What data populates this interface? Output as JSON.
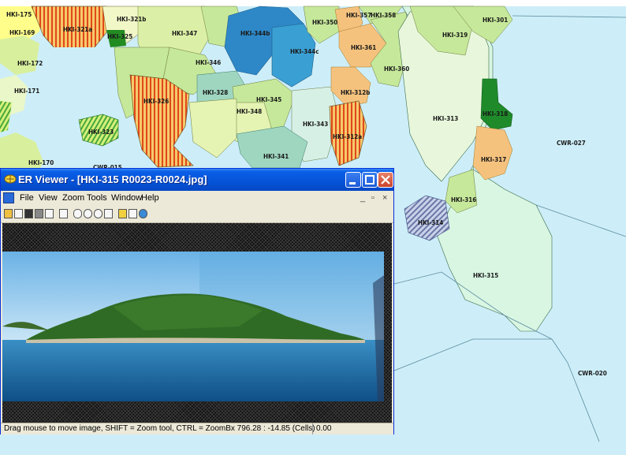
{
  "map": {
    "labels": [
      {
        "id": "HKI-175",
        "text": "HKI-175"
      },
      {
        "id": "HKI-169",
        "text": "HKI-169"
      },
      {
        "id": "HKI-172",
        "text": "HKI-172"
      },
      {
        "id": "HKI-171",
        "text": "HKI-171"
      },
      {
        "id": "HKI-170",
        "text": "HKI-170"
      },
      {
        "id": "HKI-321a",
        "text": "HKI-321a"
      },
      {
        "id": "HKI-321b",
        "text": "HKI-321b"
      },
      {
        "id": "HKI-325",
        "text": "HKI-325"
      },
      {
        "id": "HKI-347",
        "text": "HKI-347"
      },
      {
        "id": "HKI-344b",
        "text": "HKI-344b"
      },
      {
        "id": "HKI-344c",
        "text": "HKI-344c"
      },
      {
        "id": "HKI-350",
        "text": "HKI-350"
      },
      {
        "id": "HKI-357",
        "text": "HKI-357"
      },
      {
        "id": "HKI-358",
        "text": "HKI-358"
      },
      {
        "id": "HKI-301",
        "text": "HKI-301"
      },
      {
        "id": "HKI-319",
        "text": "HKI-319"
      },
      {
        "id": "HKI-346",
        "text": "HKI-346"
      },
      {
        "id": "HKI-361",
        "text": "HKI-361"
      },
      {
        "id": "HKI-360",
        "text": "HKI-360"
      },
      {
        "id": "HKI-326",
        "text": "HKI-326"
      },
      {
        "id": "HKI-328",
        "text": "HKI-328"
      },
      {
        "id": "HKI-345",
        "text": "HKI-345"
      },
      {
        "id": "HKI-348",
        "text": "HKI-348"
      },
      {
        "id": "HKI-312b",
        "text": "HKI-312b"
      },
      {
        "id": "HKI-313",
        "text": "HKI-313"
      },
      {
        "id": "HKI-318",
        "text": "HKI-318"
      },
      {
        "id": "HKI-323",
        "text": "HKI-323"
      },
      {
        "id": "HKI-343",
        "text": "HKI-343"
      },
      {
        "id": "HKI-312a",
        "text": "HKI-312a"
      },
      {
        "id": "CWR-027",
        "text": "CWR-027"
      },
      {
        "id": "HKI-341",
        "text": "HKI-341"
      },
      {
        "id": "CWR-015",
        "text": "CWR-015"
      },
      {
        "id": "HKI-317",
        "text": "HKI-317"
      },
      {
        "id": "HKI-316",
        "text": "HKI-316"
      },
      {
        "id": "HKI-314",
        "text": "HKI-314"
      },
      {
        "id": "HKI-315",
        "text": "HKI-315"
      },
      {
        "id": "CWR-020",
        "text": "CWR-020"
      }
    ]
  },
  "viewer": {
    "title": "ER Viewer - [HKI-315 R0023-R0024.jpg]",
    "menu": [
      "File",
      "View",
      "Zoom",
      "Tools",
      "Window",
      "Help"
    ],
    "mdi_controls": [
      "_",
      "໮",
      "×"
    ],
    "status_text": "Drag mouse to move image, SHIFT = Zoom tool, CTRL = ZoomBx 796.28 : -14.85 (Cells)",
    "status_value": "0.00"
  },
  "colors": {
    "sea": "#cdeef8",
    "titlebar": "#0553d6",
    "water_photo": "#1d6e9e"
  }
}
